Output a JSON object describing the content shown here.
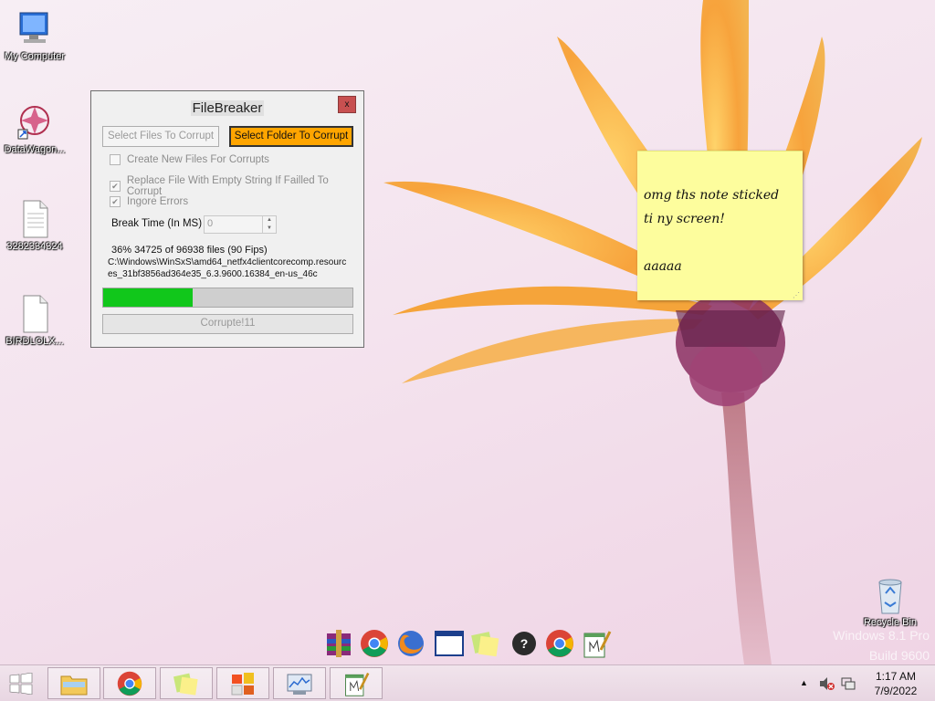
{
  "desktop": {
    "icons": [
      {
        "label": "My Computer",
        "icon": "computer-icon"
      },
      {
        "label": "DataWagon...",
        "icon": "shortcut-icon"
      },
      {
        "label": "3282334324",
        "icon": "file-icon"
      },
      {
        "label": "BIRDLOLX...",
        "icon": "file-icon"
      },
      {
        "label": "Recycle Bin",
        "icon": "recycle-bin-icon"
      }
    ]
  },
  "filebreaker": {
    "title": "FileBreaker",
    "close_label": "x",
    "select_files_label": "Select Files To Corrupt",
    "select_folder_label": "Select Folder To Corrupt",
    "options": [
      {
        "label": "Create New Files For Corrupts",
        "checked": false
      },
      {
        "label": "Replace File With Empty String If Failled To Corrupt",
        "checked": true
      },
      {
        "label": "Ingore Errors",
        "checked": true
      }
    ],
    "break_time_label": "Break Time (In MS)",
    "break_time_value": "0",
    "status": "36% 34725 of 96938 files (90 Fips)",
    "current_file": "C:\\Windows\\WinSxS\\amd64_netfx4clientcorecomp.resources_31bf3856ad364e35_6.3.9600.16384_en-us_46c",
    "progress": 0.36,
    "corrupt_label": "Corrupte!11"
  },
  "sticky_note": {
    "text": "omg ths note sticked\nti ny screen!\n\naaaaa"
  },
  "dock": [
    "rar-icon",
    "chrome-icon",
    "firefox-icon",
    "window-icon",
    "sticky-notes-icon",
    "help-icon",
    "chrome-icon",
    "notepad-icon"
  ],
  "watermark": {
    "line1": "Windows 8.1 Pro",
    "line2": "Build 9600"
  },
  "taskbar": {
    "items": [
      "file-explorer-icon",
      "chrome-icon",
      "sticky-notes-icon",
      "windows-flag-icon",
      "resource-monitor-icon",
      "notepad-icon"
    ],
    "time": "1:17 AM",
    "date": "7/9/2022"
  }
}
